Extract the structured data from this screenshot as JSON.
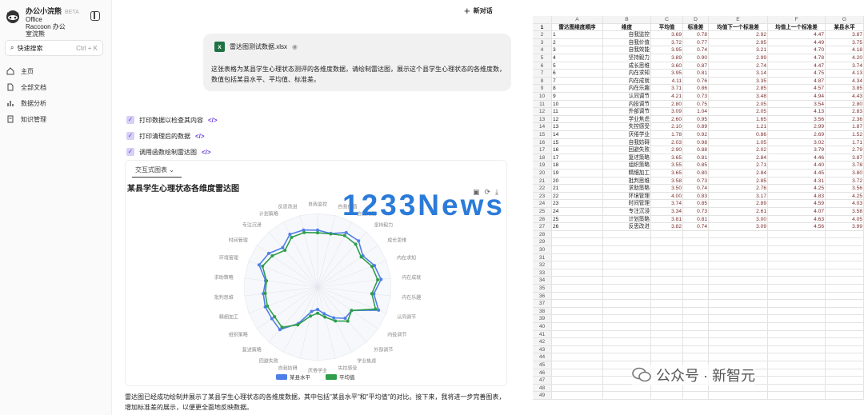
{
  "brand": {
    "name": "办公小浣熊",
    "tag": "BETA",
    "sub1": "Office",
    "sub2": "Raccoon 办公",
    "sub3": "室浣熊"
  },
  "search": {
    "label": "快速搜索",
    "shortcut": "Ctrl + K"
  },
  "nav": [
    {
      "label": "主页",
      "icon": "home-icon"
    },
    {
      "label": "全部文档",
      "icon": "document-icon"
    },
    {
      "label": "数据分析",
      "icon": "chart-icon"
    },
    {
      "label": "知识管理",
      "icon": "book-icon"
    }
  ],
  "header": {
    "new_chat": "新对话"
  },
  "user_message": {
    "file": "雷达图测试数据.xlsx",
    "text": "这张表格为某县学生心理状态测评的各维度数据，请绘制雷达图，展示这个县学生心理状态的各维度数，数值包括某县水平、平均值、标准差。"
  },
  "steps": [
    {
      "label": "打印数据以检查其内容",
      "code": "</>"
    },
    {
      "label": "打印清理后的数据",
      "code": "</>"
    },
    {
      "label": "调用函数绘制雷达图",
      "code": "</>"
    }
  ],
  "card": {
    "tab": "交互式图表 ⌄",
    "chart_title": "某县学生心理状态各维度雷达图",
    "tools": [
      "▣",
      "⟳",
      "⤓"
    ]
  },
  "chart_data": {
    "type": "radar",
    "categories": [
      "自我监控",
      "自我价值",
      "自我效能",
      "坚持毅力",
      "成长思维",
      "内在求知",
      "内在成就",
      "内在乐趣",
      "认同调节",
      "内投调节",
      "外部调节",
      "学业焦虑",
      "失控感受",
      "厌倦学业",
      "自我妨碍",
      "回避失败",
      "复述策略",
      "组织策略",
      "精细加工",
      "批判思维",
      "求助策略",
      "环境管理",
      "时间管理",
      "专注沉浸",
      "计划策略",
      "反思改进"
    ],
    "series": [
      {
        "name": "某县水平",
        "color": "#4f7ee8",
        "values": [
          3.87,
          3.75,
          4.18,
          4.2,
          3.74,
          4.13,
          4.34,
          3.85,
          4.43,
          2.8,
          2.83,
          2.36,
          1.87,
          1.52,
          1.71,
          2.79,
          3.87,
          3.78,
          3.8,
          3.72,
          3.56,
          4.25,
          4.03,
          3.58,
          4.05,
          3.99
        ]
      },
      {
        "name": "平均值",
        "color": "#2e9e4a",
        "values": [
          3.69,
          3.72,
          3.95,
          3.89,
          3.6,
          3.95,
          4.11,
          3.71,
          4.21,
          2.8,
          3.09,
          2.6,
          2.1,
          1.78,
          2.03,
          2.9,
          3.65,
          3.55,
          3.65,
          3.58,
          3.5,
          4.0,
          3.74,
          3.34,
          3.81,
          3.82
        ]
      }
    ],
    "rmax": 5,
    "legend": [
      "某县水平",
      "平均值"
    ]
  },
  "explain": "雷达图已经成功绘制并展示了某县学生心理状态的各维度数据，其中包括\"某县水平\"和\"平均值\"的对比。接下来，我将进一步完善图表，增加标准差的展示，以便更全面地反映数据。",
  "sheet": {
    "cols": [
      "A",
      "B",
      "C",
      "D",
      "E",
      "F",
      "G"
    ],
    "headers": [
      "雷达图维度顺序",
      "维度",
      "平均值",
      "标准差",
      "均值下一个标准差",
      "均值上一个标准差",
      "某县水平"
    ],
    "rows": [
      [
        1,
        "自我监控",
        "3.69",
        "0.78",
        "2.92",
        "4.47",
        "3.87"
      ],
      [
        2,
        "自我价值",
        "3.72",
        "0.77",
        "2.95",
        "4.49",
        "3.75"
      ],
      [
        3,
        "自我效能",
        "3.95",
        "0.74",
        "3.21",
        "4.70",
        "4.18"
      ],
      [
        4,
        "坚持毅力",
        "3.89",
        "0.90",
        "2.99",
        "4.78",
        "4.20"
      ],
      [
        5,
        "成长思维",
        "3.60",
        "0.87",
        "2.74",
        "4.47",
        "3.74"
      ],
      [
        6,
        "内在求知",
        "3.95",
        "0.81",
        "3.14",
        "4.75",
        "4.13"
      ],
      [
        7,
        "内在成就",
        "4.11",
        "0.76",
        "3.35",
        "4.87",
        "4.34"
      ],
      [
        8,
        "内在乐趣",
        "3.71",
        "0.86",
        "2.85",
        "4.57",
        "3.85"
      ],
      [
        9,
        "认同调节",
        "4.21",
        "0.73",
        "3.48",
        "4.94",
        "4.43"
      ],
      [
        10,
        "内投调节",
        "2.80",
        "0.75",
        "2.05",
        "3.54",
        "2.80"
      ],
      [
        11,
        "外部调节",
        "3.09",
        "1.04",
        "2.05",
        "4.13",
        "2.83"
      ],
      [
        12,
        "学业焦虑",
        "2.60",
        "0.95",
        "1.65",
        "3.56",
        "2.36"
      ],
      [
        13,
        "失控感受",
        "2.10",
        "0.89",
        "1.21",
        "2.99",
        "1.87"
      ],
      [
        14,
        "厌倦学业",
        "1.78",
        "0.92",
        "0.86",
        "2.69",
        "1.52"
      ],
      [
        15,
        "自我妨碍",
        "2.03",
        "0.98",
        "1.05",
        "3.02",
        "1.71"
      ],
      [
        16,
        "回避失败",
        "2.90",
        "0.88",
        "2.02",
        "3.79",
        "2.79"
      ],
      [
        17,
        "复述策略",
        "3.65",
        "0.81",
        "2.84",
        "4.46",
        "3.87"
      ],
      [
        18,
        "组织策略",
        "3.55",
        "0.85",
        "2.71",
        "4.40",
        "3.78"
      ],
      [
        19,
        "精细加工",
        "3.65",
        "0.80",
        "2.84",
        "4.45",
        "3.80"
      ],
      [
        20,
        "批判思维",
        "3.58",
        "0.73",
        "2.85",
        "4.31",
        "3.72"
      ],
      [
        21,
        "求助策略",
        "3.50",
        "0.74",
        "2.76",
        "4.25",
        "3.56"
      ],
      [
        22,
        "环境管理",
        "4.00",
        "0.83",
        "3.17",
        "4.83",
        "4.25"
      ],
      [
        23,
        "时间管理",
        "3.74",
        "0.85",
        "2.89",
        "4.59",
        "4.03"
      ],
      [
        24,
        "专注沉浸",
        "3.34",
        "0.73",
        "2.61",
        "4.07",
        "3.58"
      ],
      [
        25,
        "计划策略",
        "3.81",
        "0.81",
        "3.00",
        "4.63",
        "4.05"
      ],
      [
        26,
        "反思改进",
        "3.82",
        "0.74",
        "3.09",
        "4.56",
        "3.99"
      ]
    ],
    "empty_rows": [
      28,
      29,
      30,
      31,
      32,
      33,
      34,
      35,
      36,
      37,
      38,
      39,
      40,
      41,
      42,
      43,
      44,
      45,
      46,
      47,
      48,
      49,
      50
    ]
  },
  "watermark": "1233News",
  "wechat": "公众号 · 新智元"
}
